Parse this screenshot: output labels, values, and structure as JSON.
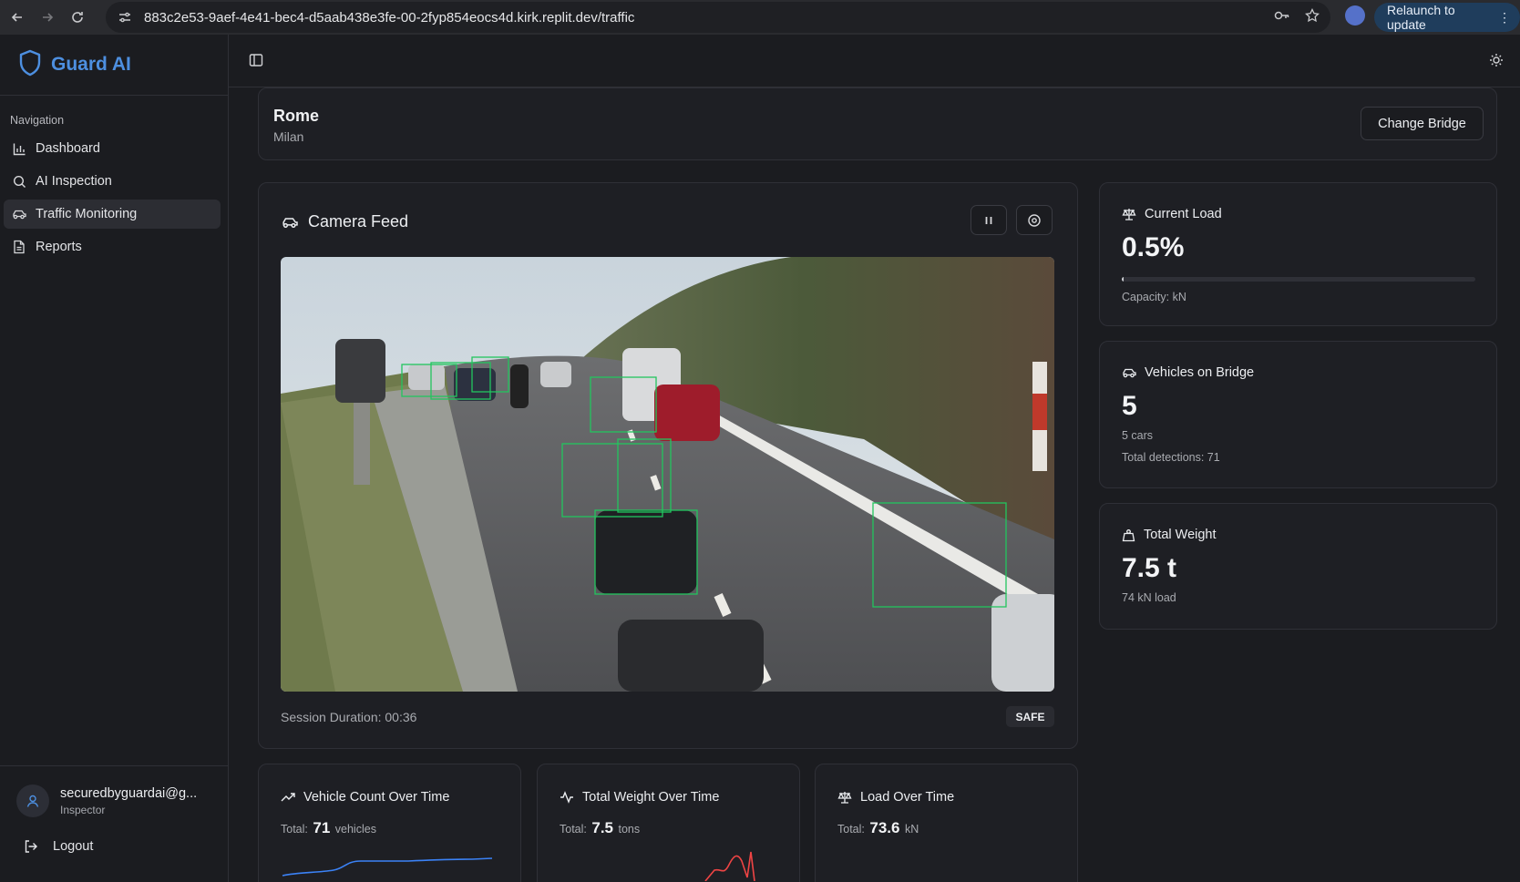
{
  "browser": {
    "url": "883c2e53-9aef-4e41-bec4-d5aab438e3fe-00-2fyp854eocs4d.kirk.replit.dev/traffic",
    "relaunch_label": "Relaunch to update"
  },
  "app": {
    "brand": "Guard AI"
  },
  "sidebar": {
    "heading": "Navigation",
    "items": [
      {
        "label": "Dashboard",
        "icon": "bar-chart-icon"
      },
      {
        "label": "AI Inspection",
        "icon": "search-icon"
      },
      {
        "label": "Traffic Monitoring",
        "icon": "car-icon",
        "active": true
      },
      {
        "label": "Reports",
        "icon": "file-text-icon"
      }
    ],
    "user": {
      "email": "securedbyguardai@g...",
      "role": "Inspector"
    },
    "logout_label": "Logout"
  },
  "bridge": {
    "name": "Rome",
    "city": "Milan",
    "change_label": "Change Bridge"
  },
  "camera": {
    "title": "Camera Feed",
    "session_label": "Session Duration: 00:36",
    "status": "SAFE"
  },
  "stats": {
    "current_load": {
      "title": "Current Load",
      "value": "0.5%",
      "progress": 0.005,
      "capacity": "Capacity: kN"
    },
    "vehicles": {
      "title": "Vehicles on Bridge",
      "value": "5",
      "sub1": "5 cars",
      "sub2": "Total detections: 71"
    },
    "weight": {
      "title": "Total Weight",
      "value": "7.5 t",
      "sub": "74 kN load"
    }
  },
  "mini_charts": [
    {
      "title": "Vehicle Count Over Time",
      "prefix": "Total:",
      "value": "71",
      "unit": "vehicles",
      "color": "#3b82f6"
    },
    {
      "title": "Total Weight Over Time",
      "prefix": "Total:",
      "value": "7.5",
      "unit": "tons",
      "color": "#ef4444"
    },
    {
      "title": "Load Over Time",
      "prefix": "Total:",
      "value": "73.6",
      "unit": "kN",
      "color": "#22c55e"
    }
  ],
  "colors": {
    "brand": "#4d8fe0",
    "detection_box": "#22c55e",
    "background": "#1b1c20"
  }
}
